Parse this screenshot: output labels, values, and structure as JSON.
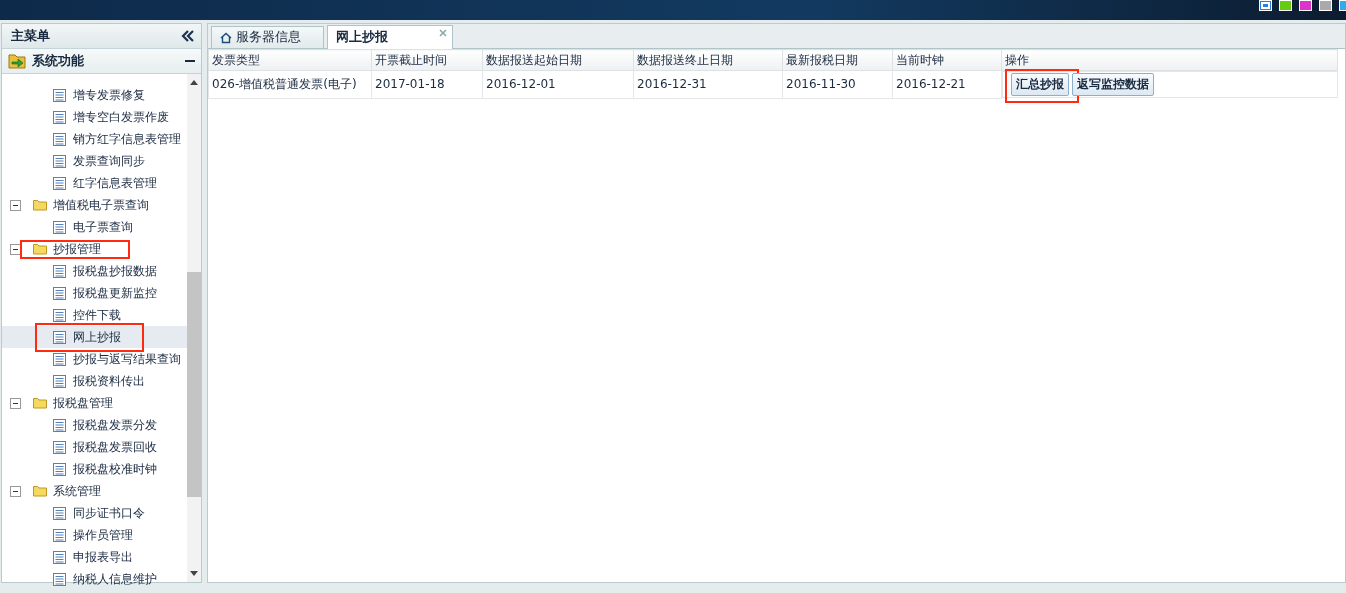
{
  "theme_swatches": [
    {
      "color": "#2a7fe0",
      "selected": true
    },
    {
      "color": "#66cc11"
    },
    {
      "color": "#dd33cc"
    },
    {
      "color": "#aaaaaa"
    },
    {
      "color": "#33aaee"
    }
  ],
  "sidebar": {
    "title": "主菜单",
    "section": {
      "label": "系统功能",
      "expanded": true
    },
    "tree": [
      {
        "children": [
          {
            "label": "增专发票修复"
          },
          {
            "label": "增专空白发票作废"
          },
          {
            "label": "销方红字信息表管理"
          },
          {
            "label": "发票查询同步"
          },
          {
            "label": "红字信息表管理"
          }
        ]
      },
      {
        "label": "增值税电子票查询",
        "expanded": true,
        "children": [
          {
            "label": "电子票查询"
          }
        ]
      },
      {
        "label": "抄报管理",
        "expanded": true,
        "highlighted": true,
        "children": [
          {
            "label": "报税盘抄报数据"
          },
          {
            "label": "报税盘更新监控"
          },
          {
            "label": "控件下载"
          },
          {
            "label": "网上抄报",
            "selected": true,
            "highlighted": true
          },
          {
            "label": "抄报与返写结果查询"
          },
          {
            "label": "报税资料传出"
          }
        ]
      },
      {
        "label": "报税盘管理",
        "expanded": true,
        "children": [
          {
            "label": "报税盘发票分发"
          },
          {
            "label": "报税盘发票回收"
          },
          {
            "label": "报税盘校准时钟"
          }
        ]
      },
      {
        "label": "系统管理",
        "expanded": true,
        "children": [
          {
            "label": "同步证书口令"
          },
          {
            "label": "操作员管理"
          },
          {
            "label": "申报表导出"
          },
          {
            "label": "纳税人信息维护"
          }
        ]
      }
    ]
  },
  "tabs": [
    {
      "label": "服务器信息",
      "selected": false,
      "kind": "home"
    },
    {
      "label": "网上抄报",
      "selected": true,
      "kind": "closable"
    }
  ],
  "table": {
    "columns": [
      "发票类型",
      "开票截止时间",
      "数据报送起始日期",
      "数据报送终止日期",
      "最新报税日期",
      "当前时钟",
      "操作"
    ],
    "rows": [
      {
        "cells": [
          "026-增值税普通发票(电子)",
          "2017-01-18",
          "2016-12-01",
          "2016-12-31",
          "2016-11-30",
          "2016-12-21"
        ],
        "actions": [
          {
            "label": "汇总抄报",
            "highlighted": true
          },
          {
            "label": "返写监控数据",
            "highlighted": false
          }
        ]
      }
    ]
  }
}
